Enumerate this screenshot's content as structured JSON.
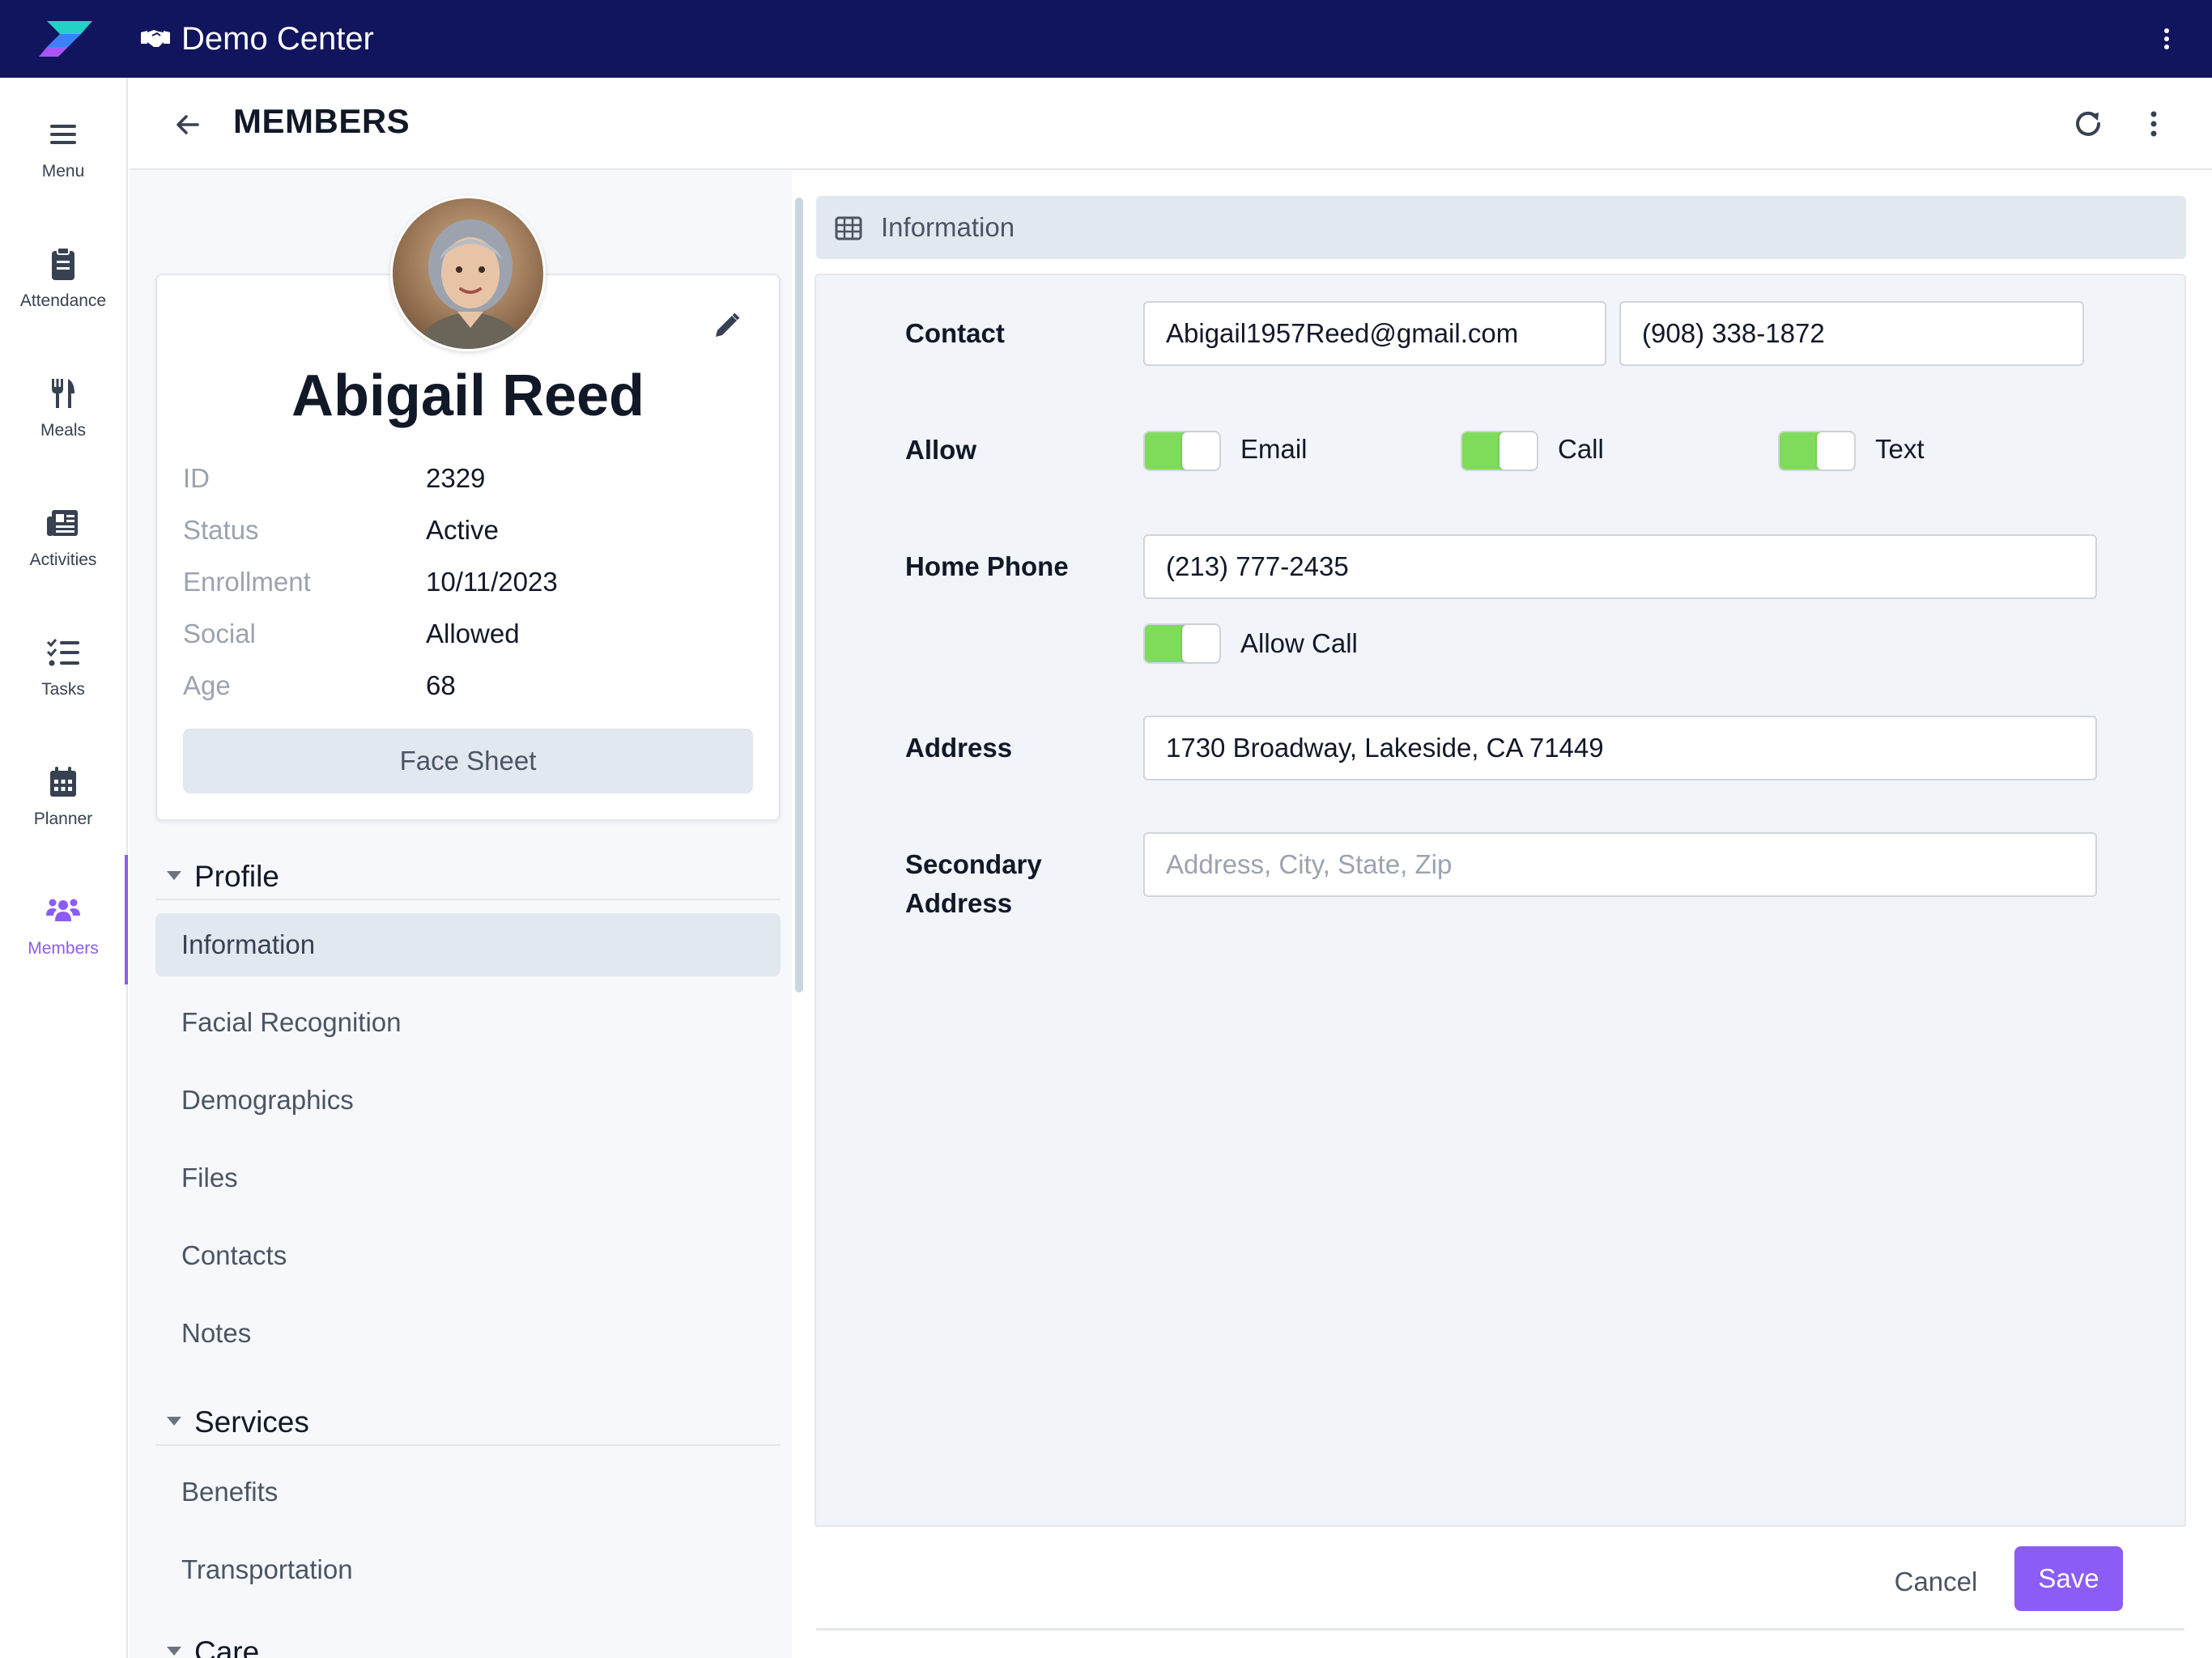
{
  "topbar": {
    "org_name": "Demo Center",
    "brand_color": "#11155e",
    "org_icon": "handshake-icon"
  },
  "rail": {
    "items": [
      {
        "label": "Menu",
        "icon": "hamburger-icon"
      },
      {
        "label": "Attendance",
        "icon": "clipboard-icon"
      },
      {
        "label": "Meals",
        "icon": "utensils-icon"
      },
      {
        "label": "Activities",
        "icon": "newspaper-icon"
      },
      {
        "label": "Tasks",
        "icon": "checklist-icon"
      },
      {
        "label": "Planner",
        "icon": "calendar-icon"
      },
      {
        "label": "Members",
        "icon": "users-icon",
        "active": true
      }
    ],
    "accent": "#8b5cf6"
  },
  "header": {
    "title": "MEMBERS"
  },
  "profile": {
    "name": "Abigail Reed",
    "fields": [
      {
        "key": "ID",
        "value": "2329"
      },
      {
        "key": "Status",
        "value": "Active"
      },
      {
        "key": "Enrollment",
        "value": "10/11/2023"
      },
      {
        "key": "Social",
        "value": "Allowed"
      },
      {
        "key": "Age",
        "value": "68"
      }
    ],
    "face_sheet_label": "Face Sheet"
  },
  "nav": {
    "sections": [
      {
        "title": "Profile",
        "items": [
          "Information",
          "Facial Recognition",
          "Demographics",
          "Files",
          "Contacts",
          "Notes"
        ]
      },
      {
        "title": "Services",
        "items": [
          "Benefits",
          "Transportation"
        ]
      },
      {
        "title": "Care",
        "items": []
      }
    ],
    "selected": "Information"
  },
  "form": {
    "section_title": "Information",
    "contact_label": "Contact",
    "email_value": "Abigail1957Reed@gmail.com",
    "phone_value": "(908) 338-1872",
    "allow_label": "Allow",
    "allow_email": {
      "label": "Email",
      "on": true
    },
    "allow_call": {
      "label": "Call",
      "on": true
    },
    "allow_text": {
      "label": "Text",
      "on": true
    },
    "home_phone_label": "Home Phone",
    "home_phone_value": "(213) 777-2435",
    "home_allow_call": {
      "label": "Allow Call",
      "on": true
    },
    "address_label": "Address",
    "address_value": "1730 Broadway, Lakeside, CA 71449",
    "secondary_label_1": "Secondary",
    "secondary_label_2": "Address",
    "secondary_placeholder": "Address, City, State, Zip",
    "toggle_color": "#7fdc5a"
  },
  "footer": {
    "cancel_label": "Cancel",
    "save_label": "Save"
  }
}
